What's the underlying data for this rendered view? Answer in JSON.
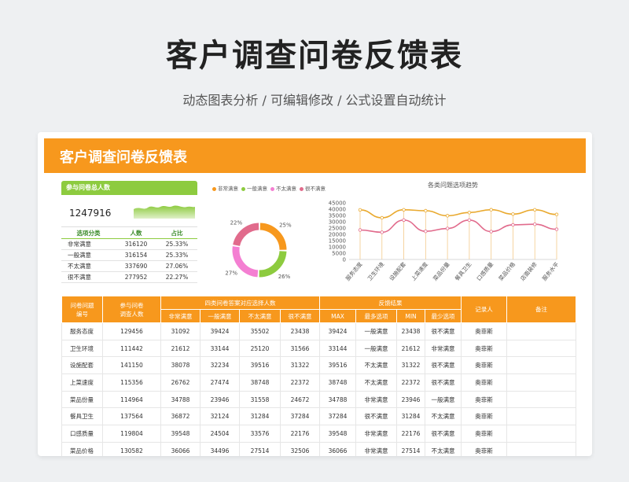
{
  "hero": {
    "title": "客户调查问卷反馈表",
    "subtitle": "动态图表分析 /  可编辑修改  /  公式设置自动统计"
  },
  "banner": {
    "title": "客户调查问卷反馈表"
  },
  "summary": {
    "header": "参与问卷总人数",
    "total": "1247916",
    "columns": [
      "选项分类",
      "人数",
      "占比"
    ],
    "rows": [
      [
        "非常满意",
        "316120",
        "25.33%"
      ],
      [
        "一般满意",
        "316154",
        "25.33%"
      ],
      [
        "不太满意",
        "337690",
        "27.06%"
      ],
      [
        "很不满意",
        "277952",
        "22.27%"
      ]
    ]
  },
  "colors": {
    "orange": "#f7981d",
    "green": "#8dcb3f",
    "pink": "#f47fd2",
    "rose": "#e16b8c",
    "gold": "#e9a92e"
  },
  "chart_data": [
    {
      "type": "pie",
      "legend": [
        "非常满意",
        "一般满意",
        "不太满意",
        "很不满意"
      ],
      "categories": [
        "非常满意",
        "一般满意",
        "不太满意",
        "很不满意"
      ],
      "values": [
        25.33,
        25.33,
        27.06,
        22.27
      ],
      "labels": [
        "25%",
        "26%",
        "27%",
        "22%"
      ],
      "colors": [
        "#f7981d",
        "#8dcb3f",
        "#f47fd2",
        "#e16b8c"
      ],
      "legend_placement": "top"
    },
    {
      "type": "line",
      "title": "各类问题选项趋势",
      "categories": [
        "服务态度",
        "卫生环境",
        "设施配套",
        "上菜速度",
        "菜品份量",
        "餐具卫生",
        "口感质量",
        "菜品价格",
        "店面装修",
        "服务水平"
      ],
      "series": [
        {
          "values": [
            39424,
            33144,
            39516,
            38748,
            34788,
            37284,
            39548,
            36066,
            39500,
            35800
          ],
          "color": "#e9a92e"
        },
        {
          "values": [
            23438,
            21612,
            31322,
            22372,
            24672,
            31284,
            22176,
            27514,
            28000,
            24000
          ],
          "color": "#e16b8c"
        }
      ],
      "yticks": [
        "45000",
        "40000",
        "35000",
        "30000",
        "25000",
        "20000",
        "15000",
        "10000",
        "5000",
        "0"
      ],
      "ylim": [
        0,
        45000
      ],
      "grid": false
    }
  ],
  "table": {
    "header_row1": {
      "qnum": "问卷问题\n编号",
      "people": "参与问卷\n调查人数",
      "group": "四类问卷答案对应选择人数",
      "feedback": "反馈结果",
      "recorder": "记录人",
      "notes": "备注"
    },
    "header_row2": [
      "非常满意",
      "一般满意",
      "不太满意",
      "很不满意",
      "MAX",
      "最多选项",
      "MIN",
      "最少选项"
    ],
    "rows": [
      [
        "服务态度",
        "129456",
        "31092",
        "39424",
        "35502",
        "23438",
        "39424",
        "一般满意",
        "23438",
        "很不满意",
        "奥菲斯",
        ""
      ],
      [
        "卫生环境",
        "111442",
        "21612",
        "33144",
        "25120",
        "31566",
        "33144",
        "一般满意",
        "21612",
        "非常满意",
        "奥菲斯",
        ""
      ],
      [
        "设施配套",
        "141150",
        "38078",
        "32234",
        "39516",
        "31322",
        "39516",
        "不太满意",
        "31322",
        "很不满意",
        "奥菲斯",
        ""
      ],
      [
        "上菜速度",
        "115356",
        "26762",
        "27474",
        "38748",
        "22372",
        "38748",
        "不太满意",
        "22372",
        "很不满意",
        "奥菲斯",
        ""
      ],
      [
        "菜品份量",
        "114964",
        "34788",
        "23946",
        "31558",
        "24672",
        "34788",
        "非常满意",
        "23946",
        "一般满意",
        "奥菲斯",
        ""
      ],
      [
        "餐具卫生",
        "137564",
        "36872",
        "32124",
        "31284",
        "37284",
        "37284",
        "很不满意",
        "31284",
        "不太满意",
        "奥菲斯",
        ""
      ],
      [
        "口感质量",
        "119804",
        "39548",
        "24504",
        "33576",
        "22176",
        "39548",
        "非常满意",
        "22176",
        "很不满意",
        "奥菲斯",
        ""
      ],
      [
        "菜品价格",
        "130582",
        "36066",
        "34496",
        "27514",
        "32506",
        "36066",
        "非常满意",
        "27514",
        "不太满意",
        "奥菲斯",
        ""
      ]
    ]
  }
}
